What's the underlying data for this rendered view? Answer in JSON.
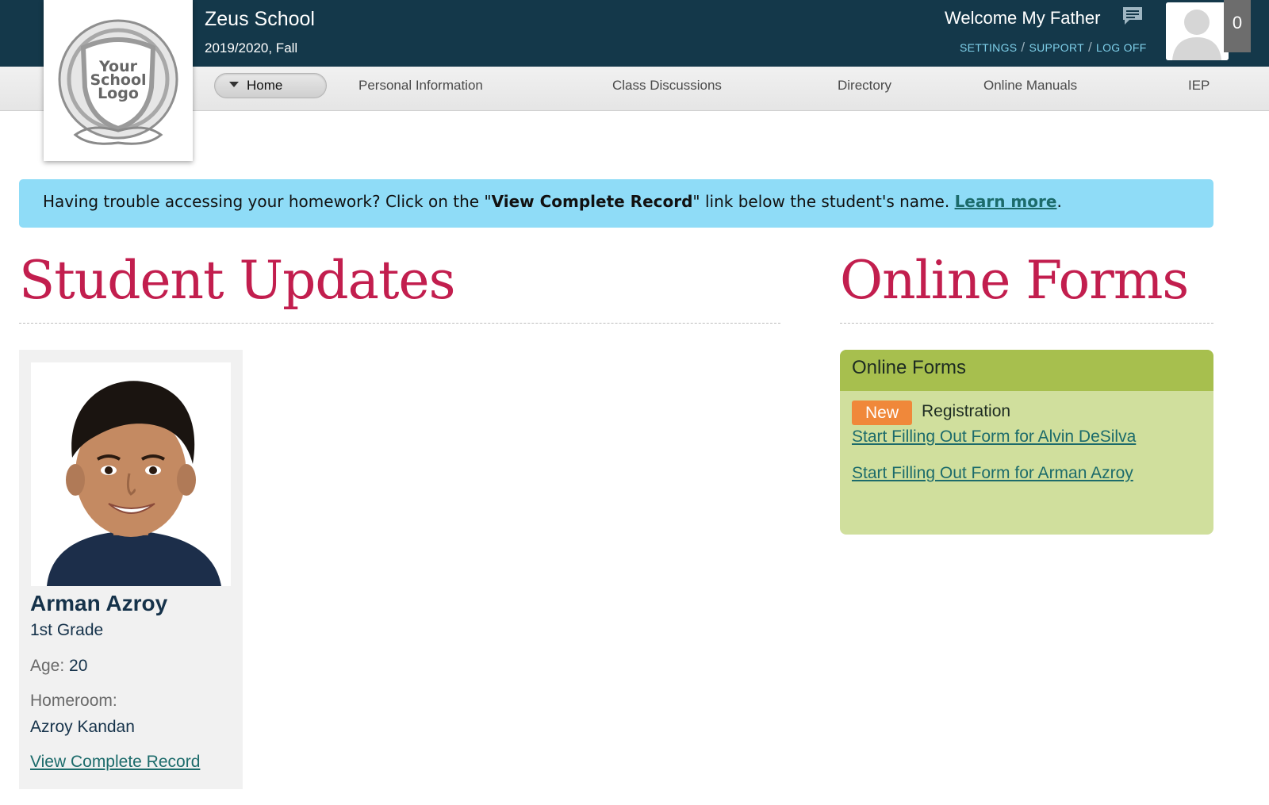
{
  "header": {
    "school_name": "Zeus School",
    "term": "2019/2020, Fall",
    "welcome": "Welcome My Father",
    "links": [
      "SETTINGS",
      "SUPPORT",
      "LOG OFF"
    ],
    "notification_count": "0",
    "chat_icon": "chat-bubble-icon",
    "logo_text": [
      "Your",
      "School",
      "Logo"
    ]
  },
  "nav": {
    "items": [
      "Home",
      "Personal Information",
      "Class Discussions",
      "Directory",
      "Online Manuals",
      "IEP"
    ],
    "active": "Home"
  },
  "alert": {
    "pre": "Having trouble accessing your homework? Click on the \"",
    "bold": "View Complete Record",
    "post": "\" link below the student's name. ",
    "link": "Learn more",
    "end": "."
  },
  "student_updates": {
    "title": "Student Updates",
    "student": {
      "name": "Arman Azroy",
      "grade": "1st Grade",
      "age_label": "Age:",
      "age": "20",
      "homeroom_label": "Homeroom:",
      "homeroom": "Azroy Kandan",
      "link": "View Complete Record"
    }
  },
  "online_forms": {
    "title": "Online Forms",
    "panel_title": "Online Forms",
    "badge": "New",
    "form_name": "Registration",
    "links": [
      "Start Filling Out Form for Alvin DeSilva",
      "Start Filling Out Form for Arman Azroy"
    ]
  },
  "colors": {
    "header_bg": "#14384a",
    "accent_title": "#c21e4e",
    "alert_bg": "#8fdcf7",
    "forms_head": "#a7bf4e",
    "forms_body": "#d0df9d",
    "badge": "#f0883a",
    "link": "#1c6b6b"
  }
}
